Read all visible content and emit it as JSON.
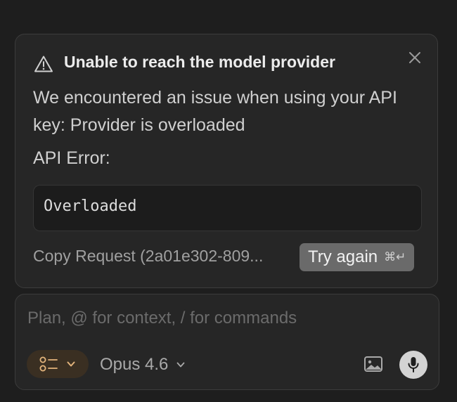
{
  "error_card": {
    "title": "Unable to reach the model provider",
    "message": "We encountered an issue when using your API key: Provider is overloaded",
    "api_error_label": "API Error:",
    "error_code": "Overloaded",
    "copy_request_label": "Copy Request (2a01e302-809...",
    "try_again_label": "Try again",
    "try_again_shortcut": "⌘↵",
    "icons": {
      "warning": "warning-triangle-icon",
      "close": "close-icon"
    }
  },
  "composer": {
    "placeholder": "Plan, @ for context, / for commands",
    "value": "",
    "mode_icon": "list-checks-icon",
    "model_label": "Opus 4.6",
    "icons": {
      "image": "image-icon",
      "mic": "microphone-icon"
    }
  },
  "colors": {
    "background": "#1e1e1e",
    "card": "#262626",
    "border": "#3c3c3c",
    "button_gray": "#6a6a6a",
    "mode_toggle_bg": "#3a2f22",
    "mode_accent": "#e3b47c",
    "mic_bg": "#d3d3d3"
  }
}
